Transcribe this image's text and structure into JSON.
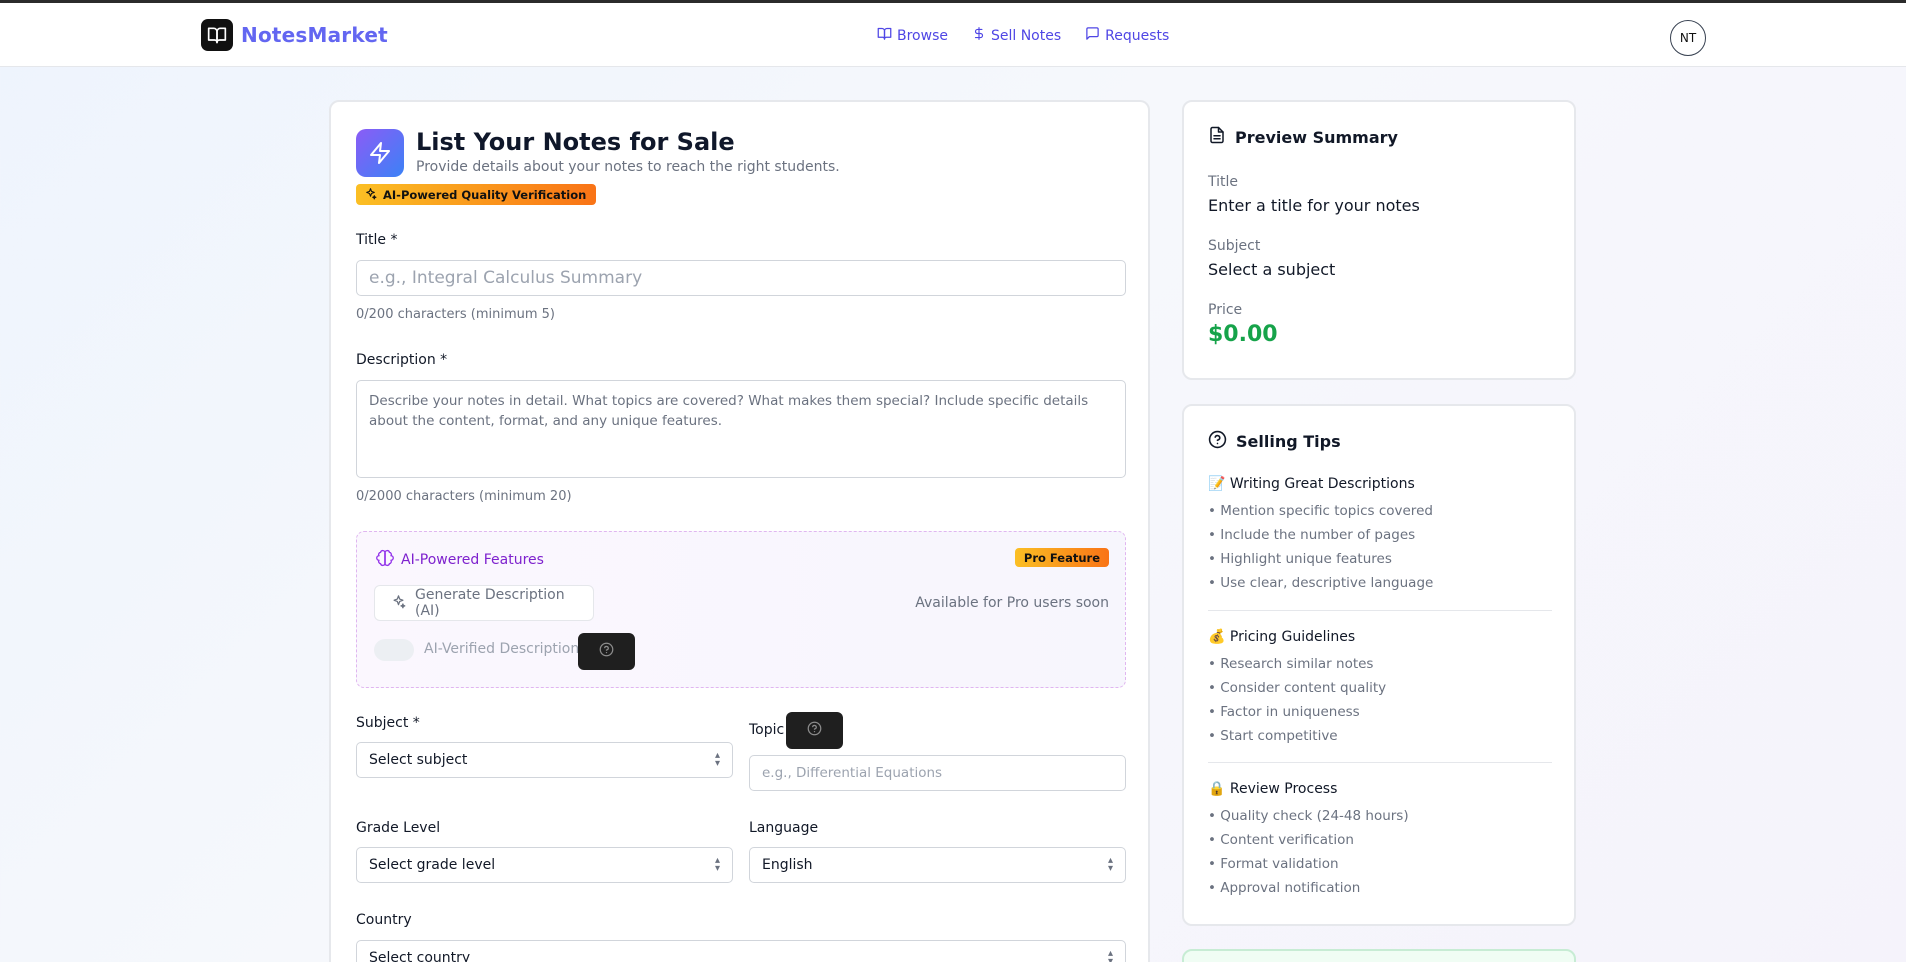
{
  "brand": {
    "name": "NotesMarket",
    "icon": "book-open-icon"
  },
  "nav": {
    "items": [
      {
        "label": "Browse",
        "icon": "book-icon"
      },
      {
        "label": "Sell Notes",
        "icon": "dollar-icon"
      },
      {
        "label": "Requests",
        "icon": "message-icon"
      }
    ]
  },
  "user": {
    "initials": "NT"
  },
  "form": {
    "title": "List Your Notes for Sale",
    "subtitle": "Provide details about your notes to reach the right students.",
    "ai_badge": "AI-Powered Quality Verification",
    "title_field": {
      "label": "Title *",
      "placeholder": "e.g., Integral Calculus Summary",
      "hint": "0/200 characters (minimum 5)"
    },
    "description_field": {
      "label": "Description *",
      "placeholder": "Describe your notes in detail. What topics are covered? What makes them special? Include specific details about the content, format, and any unique features.",
      "hint": "0/2000 characters (minimum 20)"
    },
    "ai_features": {
      "title": "AI-Powered Features",
      "pro_badge": "Pro Feature",
      "generate_button": "Generate Description (AI)",
      "availability": "Available for Pro users soon",
      "toggle_label": "AI-Verified Description"
    },
    "subject": {
      "label": "Subject *",
      "value": "Select subject"
    },
    "topic": {
      "label": "Topic",
      "placeholder": "e.g., Differential Equations"
    },
    "grade_level": {
      "label": "Grade Level",
      "value": "Select grade level"
    },
    "language": {
      "label": "Language",
      "value": "English"
    },
    "country": {
      "label": "Country",
      "value": "Select country"
    }
  },
  "preview": {
    "heading": "Preview Summary",
    "title_label": "Title",
    "title_value": "Enter a title for your notes",
    "subject_label": "Subject",
    "subject_value": "Select a subject",
    "price_label": "Price",
    "price_value": "$0.00"
  },
  "tips": {
    "heading": "Selling Tips",
    "sections": [
      {
        "title": "📝 Writing Great Descriptions",
        "items": [
          "• Mention specific topics covered",
          "• Include the number of pages",
          "• Highlight unique features",
          "• Use clear, descriptive language"
        ]
      },
      {
        "title": "💰 Pricing Guidelines",
        "items": [
          "• Research similar notes",
          "• Consider content quality",
          "• Factor in uniqueness",
          "• Start competitive"
        ]
      },
      {
        "title": "🔒 Review Process",
        "items": [
          "• Quality check (24-48 hours)",
          "• Content verification",
          "• Format validation",
          "• Approval notification"
        ]
      }
    ]
  },
  "colors": {
    "brand": "#6366f1",
    "price": "#16a34a",
    "ai_purple": "#7e22ce",
    "badge_gradient_start": "#fbbf24",
    "badge_gradient_end": "#f97316"
  }
}
